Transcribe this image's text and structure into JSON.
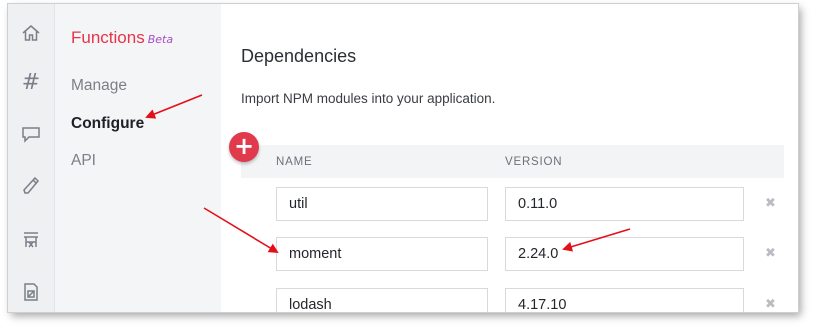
{
  "rail": {
    "items": [
      {
        "name": "home-icon"
      },
      {
        "name": "hash-icon",
        "glyph": "#"
      },
      {
        "name": "chat-icon"
      },
      {
        "name": "phone-icon"
      },
      {
        "name": "structure-icon"
      },
      {
        "name": "sim-card-icon"
      }
    ]
  },
  "nav": {
    "title": "Functions",
    "badge": "Beta",
    "items": [
      {
        "label": "Manage",
        "active": false
      },
      {
        "label": "Configure",
        "active": true
      },
      {
        "label": "API",
        "active": false
      }
    ]
  },
  "main": {
    "title": "Dependencies",
    "description": "Import NPM modules into your application.",
    "add_label": "+",
    "columns": {
      "name": "NAME",
      "version": "VERSION"
    },
    "rows": [
      {
        "name": "util",
        "version": "0.11.0"
      },
      {
        "name": "moment",
        "version": "2.24.0"
      },
      {
        "name": "lodash",
        "version": "4.17.10"
      }
    ],
    "remove_glyph": "✖"
  },
  "colors": {
    "accent": "#e8334a",
    "beta": "#a84cc4",
    "annotation": "#e3101a"
  }
}
